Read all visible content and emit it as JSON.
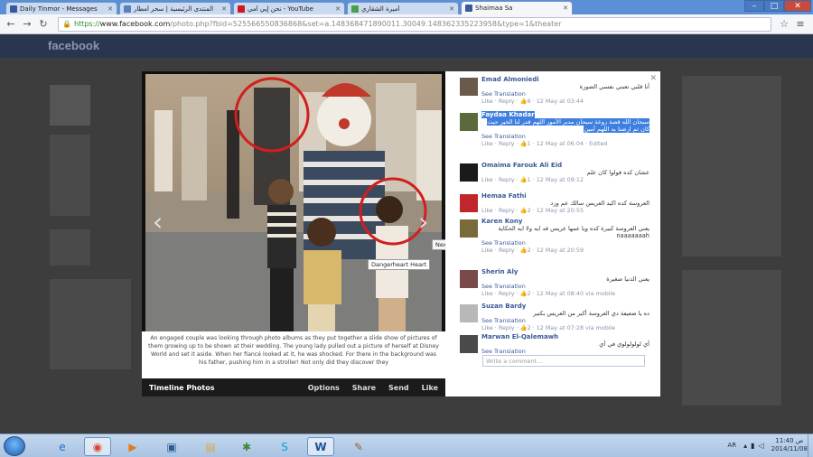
{
  "browser": {
    "tabs": [
      {
        "title": "Daily Tinmor - Messages",
        "favicon_color": "#3b5998",
        "active": false
      },
      {
        "title": "المنتدى الرئيسية | سحر أمطار",
        "favicon_color": "#5a7fc1",
        "active": false
      },
      {
        "title": "نحن إيي أمي - YouTube",
        "favicon_color": "#cc181e",
        "active": false
      },
      {
        "title": "أميرة الشقاري",
        "favicon_color": "#4aa04a",
        "active": false
      },
      {
        "title": "Shaimaa Sa",
        "favicon_color": "#3b5998",
        "active": true
      }
    ],
    "url_scheme": "https://",
    "url_host": "www.facebook.com",
    "url_rest": "/photo.php?fbid=525566550836868&set=a.148368471890011.30049.148362335223958&type=1&theater",
    "window_controls": [
      "–",
      "□",
      "✕"
    ]
  },
  "background": {
    "logo": "facebook"
  },
  "photo": {
    "tooltip_next": "Next",
    "tag_label": "Dangerheart Heart",
    "caption": "An engaged couple was looking through photo albums as they put together a slide show of pictures of them growing up to be shown at their wedding. The young lady pulled out a picture of herself at Disney World and set it aside. When her fiancé looked at it, he was shocked. For there in the background was his father, pushing him in a stroller! Not only did they discover they",
    "album_label": "Timeline Photos",
    "actions": [
      "Options",
      "Share",
      "Send",
      "Like"
    ]
  },
  "comments": [
    {
      "name": "Emad Almoniedi",
      "text": "أنا قلبي تعبني نفسي الصورة",
      "meta_prefix": "See Translation",
      "meta": "Like · Reply · 👍6 · 12 May at 03:44",
      "avatar": "#6b5a4a",
      "highlight": false
    },
    {
      "name": "Faydaa Khadar",
      "text": "سبحان الله قصة روعة سبحان مدبر الأمور اللهم قدر لنا الخير حيث كان ثم ارضنا به اللهم آمين",
      "meta_prefix": "See Translation",
      "meta": "Like · Reply · 👍1 · 12 May at 06:04 · Edited",
      "avatar": "#5a6a3a",
      "highlight": true
    },
    {
      "name": "Omaima Farouk Ali Eid",
      "text": "عشان كده قولوا كان علم",
      "meta_prefix": "",
      "meta": "Like · Reply · 👍1 · 12 May at 09:12",
      "avatar": "#1a1a1a",
      "highlight": false
    },
    {
      "name": "Hemaa Fathi",
      "text": "العروسة كده اكيد العريس سالك عم ورد",
      "meta_prefix": "",
      "meta": "Like · Reply · 👍2 · 12 May at 20:55",
      "avatar": "#c0272d",
      "highlight": false
    },
    {
      "name": "Karen Kony",
      "text": "يعني العروسة كبيرة كده ويا عمها عريس قد ايه ولا ايه الحكاية naaaaaaah",
      "meta_prefix": "See Translation",
      "meta": "Like · Reply · 👍2 · 12 May at 20:59",
      "avatar": "#7a6a3a",
      "highlight": false
    },
    {
      "name": "Sherin Aly",
      "text": "يعني الدنيا صغيرة",
      "meta_prefix": "See Translation",
      "meta": "Like · Reply · 👍2 · 12 May at 08:40 via mobile",
      "avatar": "#7a4a4a",
      "highlight": false
    },
    {
      "name": "Suzan Bardy",
      "text": "ده يا ضعيفة دي العروسة أكبر من العريس بكتير",
      "meta_prefix": "See Translation",
      "meta": "Like · Reply · 👍2 · 12 May at 07:28 via mobile",
      "avatar": "#b8b8b8",
      "highlight": false
    },
    {
      "name": "Marwan El-Qalemawh",
      "text": "أي لولولولوي في أي",
      "meta_prefix": "See Translation",
      "meta": "",
      "avatar": "#4a4a4a",
      "highlight": false
    }
  ],
  "comment_input": {
    "placeholder": "Write a comment..."
  },
  "taskbar": {
    "apps": [
      "ie-icon",
      "chrome-icon",
      "media-player-icon",
      "screen-icon",
      "folder-icon",
      "network-icon",
      "skype-icon",
      "word-icon",
      "paint-icon"
    ],
    "language": "AR",
    "time": "11:40 ص",
    "date": "2014/11/08"
  }
}
